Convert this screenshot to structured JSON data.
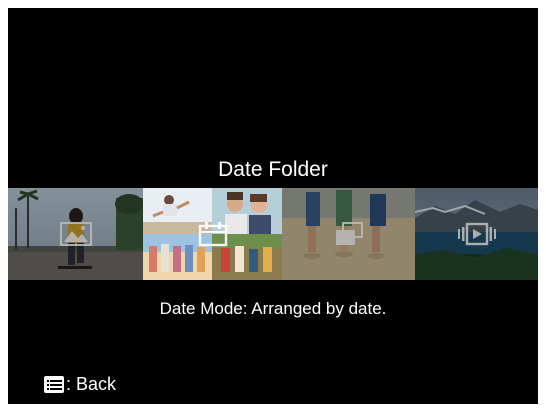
{
  "screen": {
    "title": "Date Folder",
    "description": "Date Mode: Arranged by date.",
    "back_label": ": Back"
  },
  "modes": [
    {
      "name": "single",
      "icon": "landscape-photo-icon",
      "selected": false
    },
    {
      "name": "date",
      "icon": "calendar-icon",
      "selected": true
    },
    {
      "name": "burst",
      "icon": "stacked-photos-icon",
      "selected": false
    },
    {
      "name": "video",
      "icon": "film-play-icon",
      "selected": false
    }
  ],
  "colors": {
    "background": "#000000",
    "text": "#ffffff"
  }
}
